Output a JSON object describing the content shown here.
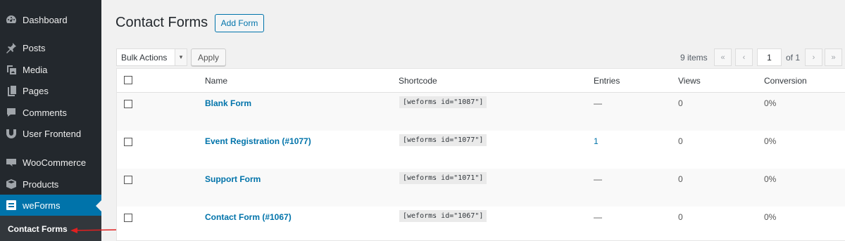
{
  "sidebar": {
    "items": [
      {
        "label": "Dashboard",
        "icon": "dashboard-icon"
      },
      {
        "label": "Posts",
        "icon": "pin-icon"
      },
      {
        "label": "Media",
        "icon": "media-icon"
      },
      {
        "label": "Pages",
        "icon": "pages-icon"
      },
      {
        "label": "Comments",
        "icon": "comments-icon"
      },
      {
        "label": "User Frontend",
        "icon": "user-frontend-icon"
      },
      {
        "label": "WooCommerce",
        "icon": "woocommerce-icon"
      },
      {
        "label": "Products",
        "icon": "products-icon"
      },
      {
        "label": "weForms",
        "icon": "weforms-icon"
      }
    ],
    "submenu": {
      "label": "Contact Forms"
    }
  },
  "header": {
    "title": "Contact Forms",
    "add_button": "Add Form"
  },
  "toolbar": {
    "bulk_actions": "Bulk Actions",
    "apply": "Apply",
    "items_count": "9 items",
    "first": "«",
    "prev": "‹",
    "page": "1",
    "of_pages": "of 1",
    "next": "›",
    "last": "»"
  },
  "table": {
    "columns": [
      "Name",
      "Shortcode",
      "Entries",
      "Views",
      "Conversion"
    ],
    "rows": [
      {
        "name": "Blank Form",
        "shortcode": "[weforms id=\"1087\"]",
        "entries": "—",
        "views": "0",
        "conversion": "0%"
      },
      {
        "name": "Event Registration (#1077)",
        "shortcode": "[weforms id=\"1077\"]",
        "entries": "1",
        "views": "0",
        "conversion": "0%"
      },
      {
        "name": "Support Form",
        "shortcode": "[weforms id=\"1071\"]",
        "entries": "—",
        "views": "0",
        "conversion": "0%"
      },
      {
        "name": "Contact Form (#1067)",
        "shortcode": "[weforms id=\"1067\"]",
        "entries": "—",
        "views": "0",
        "conversion": "0%"
      }
    ]
  },
  "colors": {
    "sidebar_bg": "#23282d",
    "accent": "#0073aa",
    "annotation_arrow": "#e02020"
  }
}
